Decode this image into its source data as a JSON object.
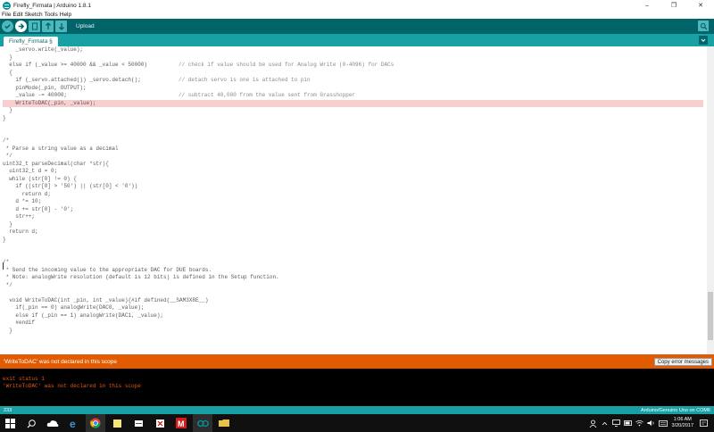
{
  "window": {
    "title": "Firefly_Firmata | Arduino 1.8.1",
    "minimize": "–",
    "maximize": "❐",
    "close": "✕"
  },
  "menu": [
    "File",
    "Edit",
    "Sketch",
    "Tools",
    "Help"
  ],
  "toolbar": {
    "action_label": "Upload"
  },
  "tab": {
    "name": "Firefly_Firmata §"
  },
  "code_lines": [
    {
      "code": "    _servo.write(_value);",
      "comment": ""
    },
    {
      "code": "  }",
      "comment": ""
    },
    {
      "code": "  else if (_value >= 40000 && _value < 50000)",
      "comment": "// check if value should be used for Analog Write (0-4096) for DACs"
    },
    {
      "code": "  {",
      "comment": ""
    },
    {
      "code": "    if (_servo.attached()) _servo.detach();",
      "comment": "// detach servo is one is attached to pin"
    },
    {
      "code": "    pinMode(_pin, OUTPUT);",
      "comment": ""
    },
    {
      "code": "    _value -= 40000;",
      "comment": "// subtract 40,000 from the value sent from Grasshopper"
    },
    {
      "code": "    WriteToDAC(_pin, _value);",
      "comment": "",
      "error": true
    },
    {
      "code": "  }",
      "comment": ""
    },
    {
      "code": "}",
      "comment": ""
    },
    {
      "code": "",
      "comment": ""
    },
    {
      "code": "",
      "comment": ""
    },
    {
      "code": "/*",
      "comment": ""
    },
    {
      "code": " * Parse a string value as a decimal",
      "comment": ""
    },
    {
      "code": " */",
      "comment": ""
    },
    {
      "code": "uint32_t parseDecimal(char *str){",
      "comment": ""
    },
    {
      "code": "  uint32_t d = 0;",
      "comment": ""
    },
    {
      "code": "  while (str[0] != 0) {",
      "comment": ""
    },
    {
      "code": "    if ((str[0] > '50') || (str[0] < '0'))",
      "comment": ""
    },
    {
      "code": "      return d;",
      "comment": ""
    },
    {
      "code": "    d *= 10;",
      "comment": ""
    },
    {
      "code": "    d += str[0] - '0';",
      "comment": ""
    },
    {
      "code": "    str++;",
      "comment": ""
    },
    {
      "code": "  }",
      "comment": ""
    },
    {
      "code": "  return d;",
      "comment": ""
    },
    {
      "code": "}",
      "comment": ""
    },
    {
      "code": "",
      "comment": ""
    },
    {
      "code": "",
      "comment": ""
    },
    {
      "code": "/*",
      "comment": ""
    },
    {
      "code": " * Send the incoming value to the appropriate DAC for DUE boards.",
      "comment": ""
    },
    {
      "code": " * Note: analogWrite resolution (default is 12 bits) is defined in the Setup function.",
      "comment": ""
    },
    {
      "code": " */",
      "comment": ""
    },
    {
      "code": "",
      "comment": ""
    },
    {
      "code": "  void WriteToDAC(int _pin, int _value){#if defined(__SAM3X8E__)",
      "comment": ""
    },
    {
      "code": "    if(_pin == 0) analogWrite(DAC0, _value);",
      "comment": ""
    },
    {
      "code": "    else if (_pin == 1) analogWrite(DAC1, _value);",
      "comment": ""
    },
    {
      "code": "    #endif",
      "comment": ""
    },
    {
      "code": "  }",
      "comment": ""
    }
  ],
  "console": {
    "header_message": "'WriteToDAC' was not declared in this scope",
    "copy_button": "Copy error messages",
    "lines": [
      "exit status 1",
      "'WriteToDAC' was not declared in this scope"
    ]
  },
  "status": {
    "line_number": "233",
    "board": "Arduino/Genuino Uno on COM6"
  },
  "taskbar": {
    "time": "1:06 AM",
    "date": "3/20/2017",
    "apps": [
      "windows-start-icon",
      "search-icon",
      "onedrive-icon",
      "edge-icon",
      "chrome-icon",
      "sticky-notes-icon",
      "scanner-icon",
      "snip-icon",
      "red-m-icon",
      "arduino-icon",
      "file-explorer-icon"
    ]
  },
  "colors": {
    "toolbar_bg": "#006468",
    "tab_bar_bg": "#17a1a5",
    "error_line_bg": "#f7cfcf",
    "console_header_bg": "#e35b00",
    "console_text": "#e25a15"
  }
}
